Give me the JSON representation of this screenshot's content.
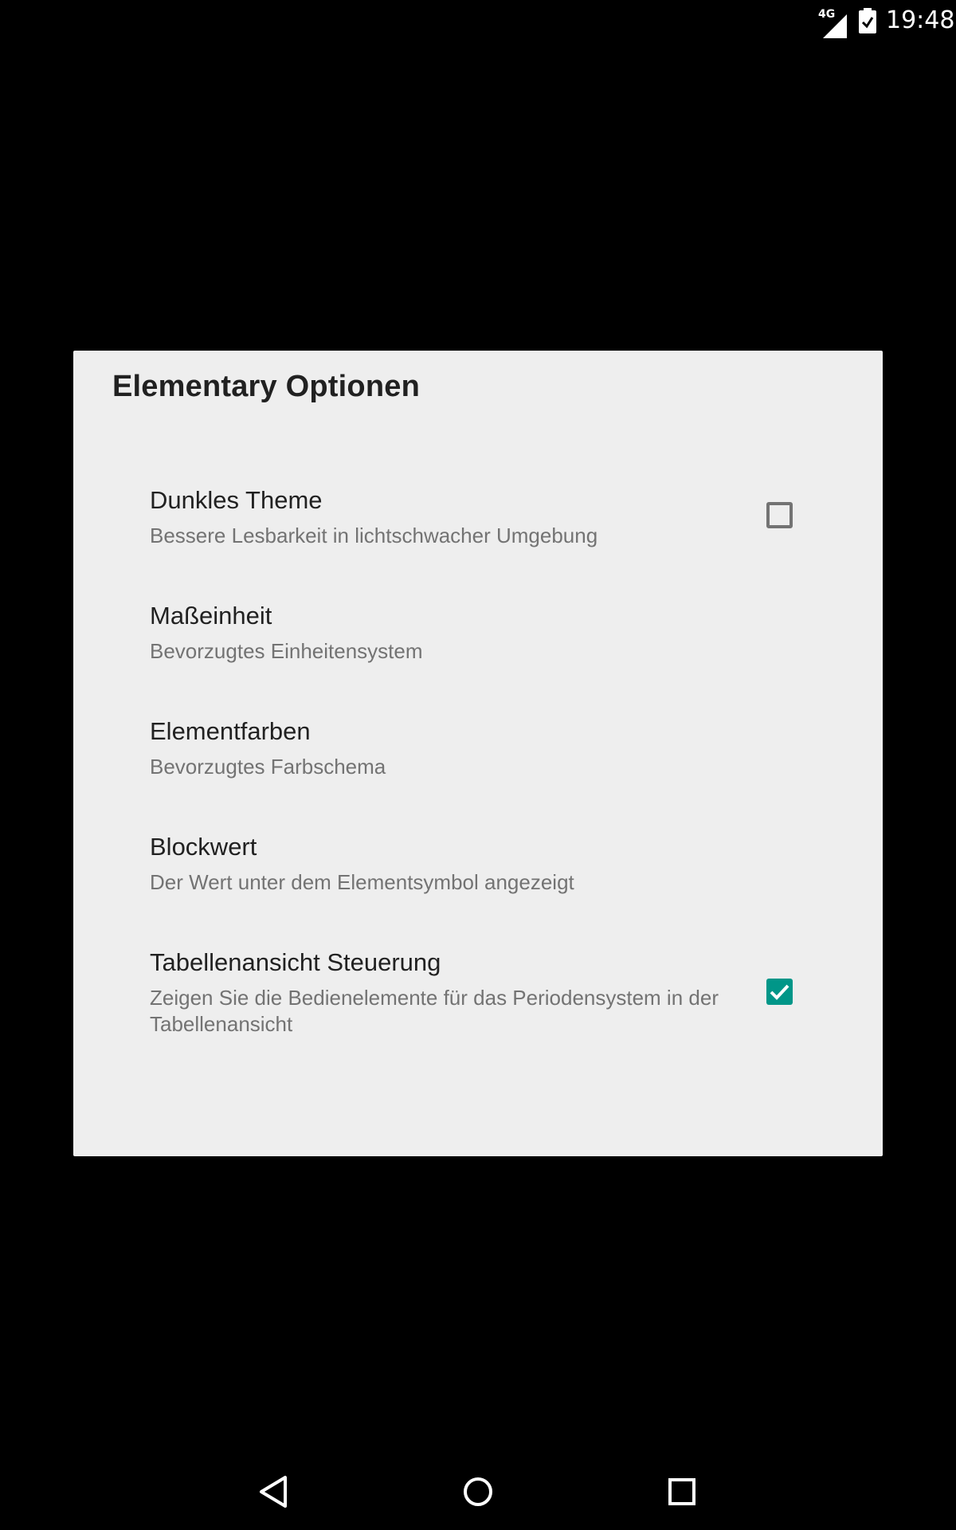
{
  "status_bar": {
    "network": "4G",
    "time": "19:48",
    "icons": [
      "signal-icon",
      "battery-icon"
    ]
  },
  "dialog": {
    "title": "Elementary Optionen",
    "items": [
      {
        "title": "Dunkles Theme",
        "summary": "Bessere Lesbarkeit in lichtschwacher Umgebung",
        "checkbox": true,
        "checked": false
      },
      {
        "title": "Maßeinheit",
        "summary": "Bevorzugtes Einheitensystem",
        "checkbox": false
      },
      {
        "title": "Elementfarben",
        "summary": "Bevorzugtes Farbschema",
        "checkbox": false
      },
      {
        "title": "Blockwert",
        "summary": "Der Wert unter dem Elementsymbol angezeigt",
        "checkbox": false
      },
      {
        "title": "Tabellenansicht Steuerung",
        "summary": "Zeigen Sie die Bedienelemente für das Periodensystem in der Tabellenansicht",
        "checkbox": true,
        "checked": true
      }
    ]
  },
  "nav_bar": {
    "buttons": [
      "back-icon",
      "home-icon",
      "recents-icon"
    ]
  },
  "colors": {
    "accent": "#009688",
    "dialog_background": "#eeeeee",
    "screen_background": "#000000",
    "title_text": "#212121",
    "summary_text": "#737373"
  }
}
